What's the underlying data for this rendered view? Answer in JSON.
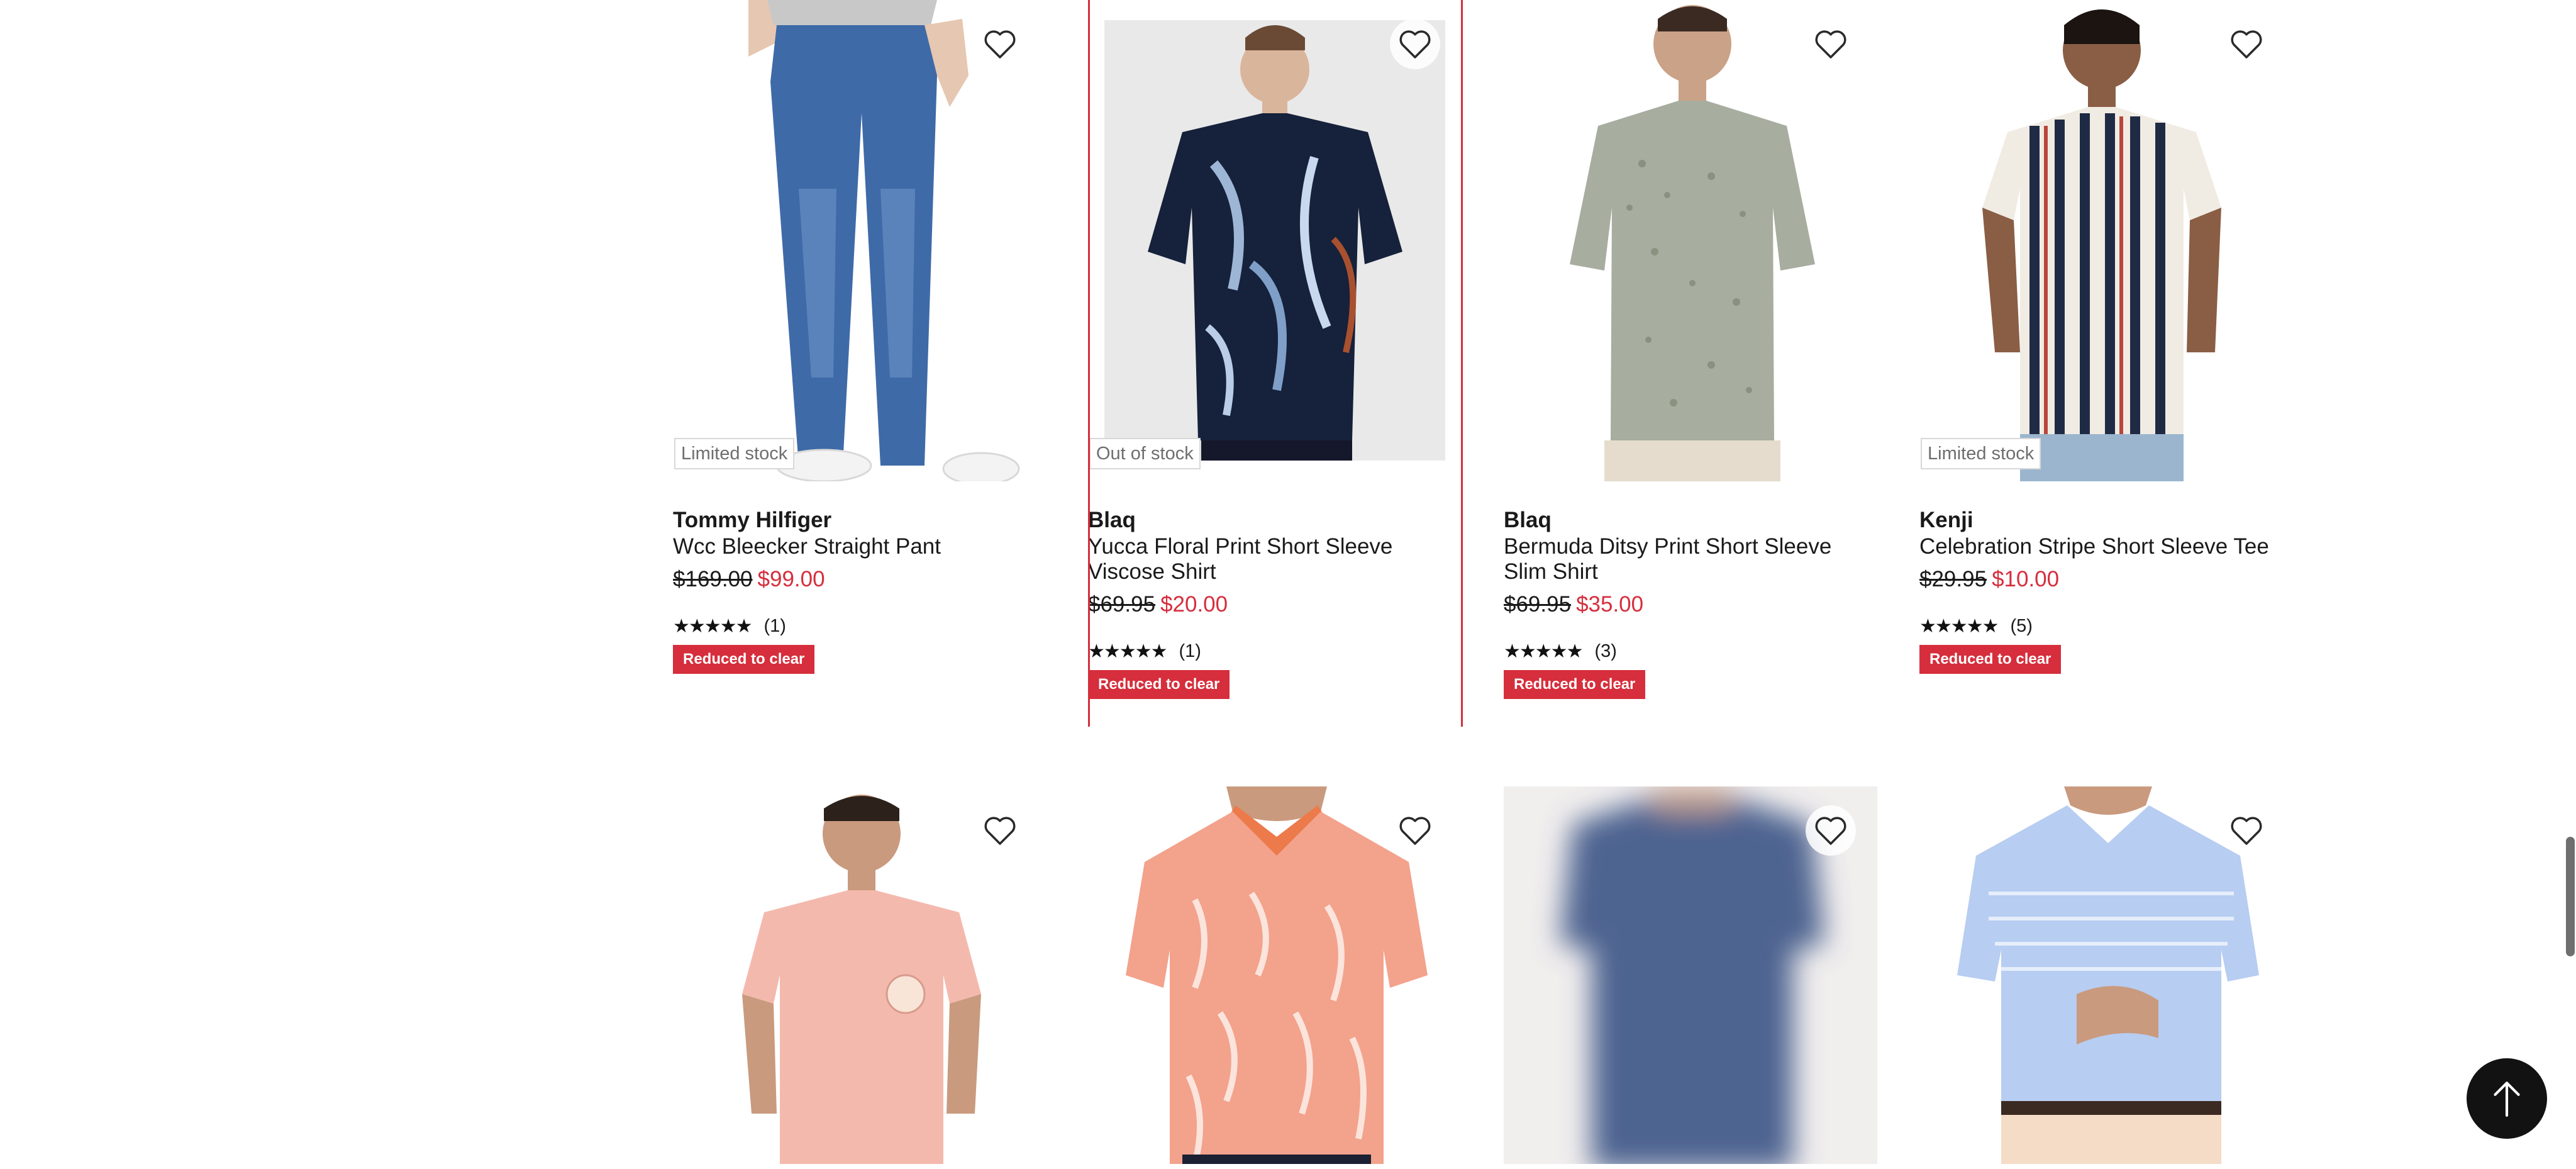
{
  "products": [
    {
      "brand": "Tommy Hilfiger",
      "name": "Wcc Bleecker Straight Pant",
      "was_price": "$169.00",
      "now_price": "$99.00",
      "stock_label": "Limited stock",
      "rating_stars": "★★★★★",
      "rating_count": "(1)",
      "badge": "Reduced to clear",
      "image": "model-in-blue-jeans"
    },
    {
      "brand": "Blaq",
      "name": "Yucca Floral Print Short Sleeve Viscose Shirt",
      "was_price": "$69.95",
      "now_price": "$20.00",
      "stock_label": "Out of stock",
      "rating_stars": "★★★★★",
      "rating_count": "(1)",
      "badge": "Reduced to clear",
      "image": "model-in-navy-palm-print-shirt"
    },
    {
      "brand": "Blaq",
      "name": "Bermuda Ditsy Print Short Sleeve Slim Shirt",
      "was_price": "$69.95",
      "now_price": "$35.00",
      "stock_label": "",
      "rating_stars": "★★★★★",
      "rating_count": "(3)",
      "badge": "Reduced to clear",
      "image": "model-in-sage-ditsy-shirt"
    },
    {
      "brand": "Kenji",
      "name": "Celebration Stripe Short Sleeve Tee",
      "was_price": "$29.95",
      "now_price": "$10.00",
      "stock_label": "Limited stock",
      "rating_stars": "★★★★★",
      "rating_count": "(5)",
      "badge": "Reduced to clear",
      "image": "model-in-striped-tee"
    }
  ],
  "row2": [
    {
      "image": "model-in-pink-tee"
    },
    {
      "image": "model-in-coral-floral-polo"
    },
    {
      "image": "blurred-navy-polo"
    },
    {
      "image": "model-in-light-blue-stripe-polo"
    }
  ],
  "colors": {
    "accent_red": "#d62e3c",
    "text": "#1a1a1a",
    "muted": "#6e6e6e"
  },
  "icons": {
    "wishlist": "heart-outline-icon",
    "back_to_top": "arrow-up-icon"
  }
}
